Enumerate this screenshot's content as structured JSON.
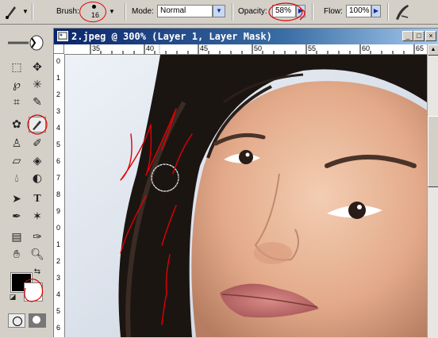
{
  "options_bar": {
    "brush_label": "Brush:",
    "brush_size": "16",
    "mode_label": "Mode:",
    "mode_value": "Normal",
    "opacity_label": "Opacity:",
    "opacity_value": "58%",
    "flow_label": "Flow:",
    "flow_value": "100%"
  },
  "document": {
    "title": "2.jpeg @ 300% (Layer 1, Layer Mask)",
    "ruler_top": [
      "35",
      "40",
      "45",
      "50",
      "55",
      "60",
      "65"
    ],
    "ruler_left": [
      "0",
      "1",
      "2",
      "3",
      "4",
      "5",
      "6",
      "7",
      "8",
      "9",
      "0",
      "1",
      "2",
      "3",
      "4",
      "5",
      "6"
    ]
  },
  "colors": {
    "title_bar": "#0a246a",
    "annotation": "#e00000",
    "foreground": "#000000",
    "background": "#ffffff"
  },
  "tools": [
    "marquee-icon",
    "move-icon",
    "lasso-icon",
    "magic-wand-icon",
    "crop-icon",
    "slice-icon",
    "healing-brush-icon",
    "brush-icon",
    "clone-stamp-icon",
    "history-brush-icon",
    "eraser-icon",
    "paint-bucket-icon",
    "blur-icon",
    "dodge-icon",
    "path-select-icon",
    "type-icon",
    "pen-icon",
    "shape-icon",
    "notes-icon",
    "eyedropper-icon",
    "hand-icon",
    "zoom-icon"
  ]
}
